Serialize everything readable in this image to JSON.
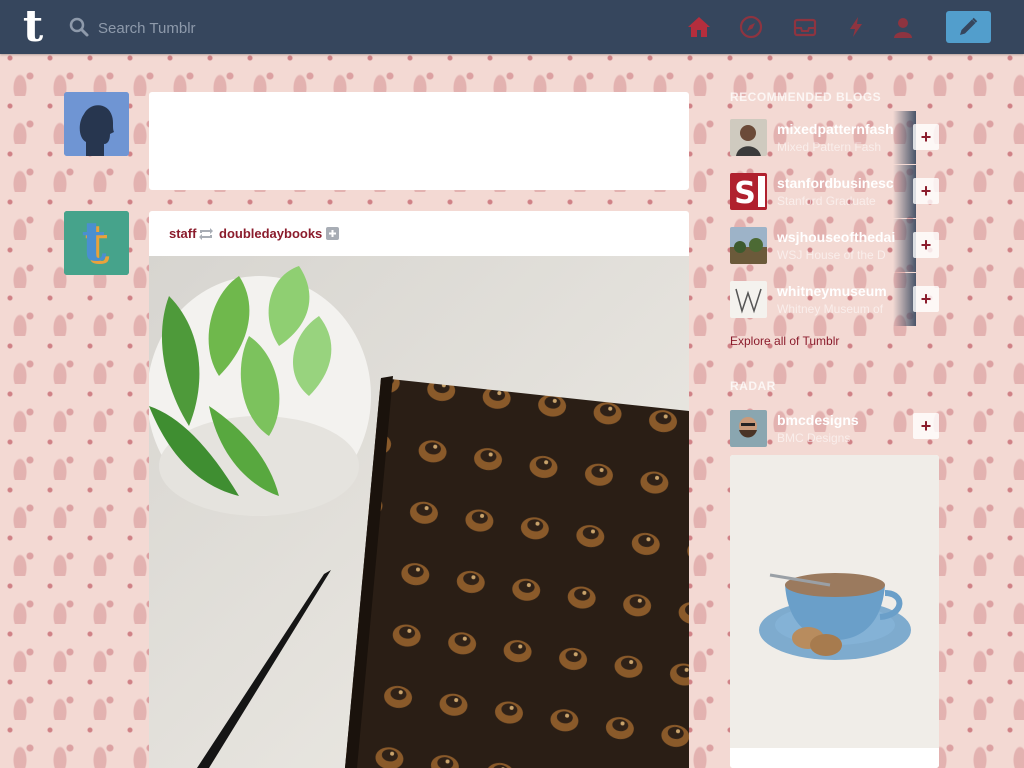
{
  "header": {
    "logo_letter": "t",
    "search_placeholder": "Search Tumblr",
    "nav_icons": [
      "home-icon",
      "compass-icon",
      "inbox-icon",
      "activity-icon",
      "account-icon"
    ],
    "compose_icon": "pencil-icon"
  },
  "colors": {
    "topbar": "#36465d",
    "accent_red": "#8b1c2c",
    "compose_blue": "#529ecc",
    "background_pattern": "#f3d9d3"
  },
  "post": {
    "reblogger": "staff",
    "reblog_icon": "reblog-icon",
    "original_blog": "doubledaybooks",
    "follow_icon": "plus-square-icon"
  },
  "sidebar": {
    "recommended_title": "RECOMMENDED BLOGS",
    "recommended": [
      {
        "name": "mixedpatternfash",
        "subtitle": "Mixed Pattern Fash"
      },
      {
        "name": "stanfordbusinesc",
        "subtitle": "Stanford Graduate"
      },
      {
        "name": "wsjhouseofthedai",
        "subtitle": "WSJ House of the D"
      },
      {
        "name": "whitneymuseum",
        "subtitle": "Whitney Museum of"
      }
    ],
    "follow_label": "+",
    "explore_label": "Explore all of Tumblr",
    "radar_title": "RADAR",
    "radar": {
      "name": "bmcdesigns",
      "subtitle": "BMC Designs"
    }
  }
}
